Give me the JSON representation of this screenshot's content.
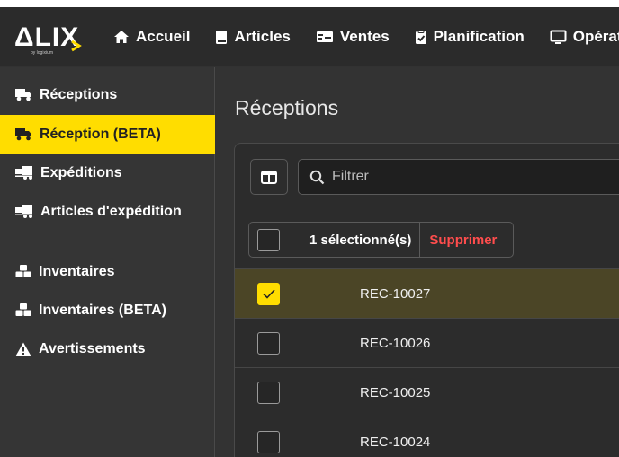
{
  "brand": {
    "logo_text": "ΔLIX",
    "logo_sub": "by logixium"
  },
  "nav": {
    "items": [
      {
        "label": "Accueil",
        "icon": "home-icon"
      },
      {
        "label": "Articles",
        "icon": "book-icon"
      },
      {
        "label": "Ventes",
        "icon": "money-icon"
      },
      {
        "label": "Planification",
        "icon": "clipboard-check-icon"
      },
      {
        "label": "Opérations",
        "icon": "monitor-icon"
      }
    ]
  },
  "sidebar": {
    "items": [
      {
        "label": "Réceptions",
        "icon": "truck-icon",
        "active": false
      },
      {
        "label": "Réception (BETA)",
        "icon": "truck-icon",
        "active": true
      },
      {
        "label": "Expéditions",
        "icon": "truck-loading-icon",
        "active": false
      },
      {
        "label": "Articles d'expédition",
        "icon": "truck-loading-icon",
        "active": false
      },
      {
        "label": "Inventaires",
        "icon": "boxes-icon",
        "active": false
      },
      {
        "label": "Inventaires (BETA)",
        "icon": "boxes-icon",
        "active": false
      },
      {
        "label": "Avertissements",
        "icon": "warning-icon",
        "active": false
      }
    ]
  },
  "main": {
    "title": "Réceptions",
    "filter": {
      "placeholder": "Filtrer",
      "value": ""
    },
    "selection": {
      "count_label": "1 sélectionné(s)",
      "delete_label": "Supprimer"
    },
    "rows": [
      {
        "id": "REC-10027",
        "checked": true
      },
      {
        "id": "REC-10026",
        "checked": false
      },
      {
        "id": "REC-10025",
        "checked": false
      },
      {
        "id": "REC-10024",
        "checked": false
      }
    ]
  },
  "colors": {
    "accent": "#ffdd00",
    "danger": "#ff4d4d",
    "selected_row": "#4b4526",
    "background": "#323232"
  }
}
